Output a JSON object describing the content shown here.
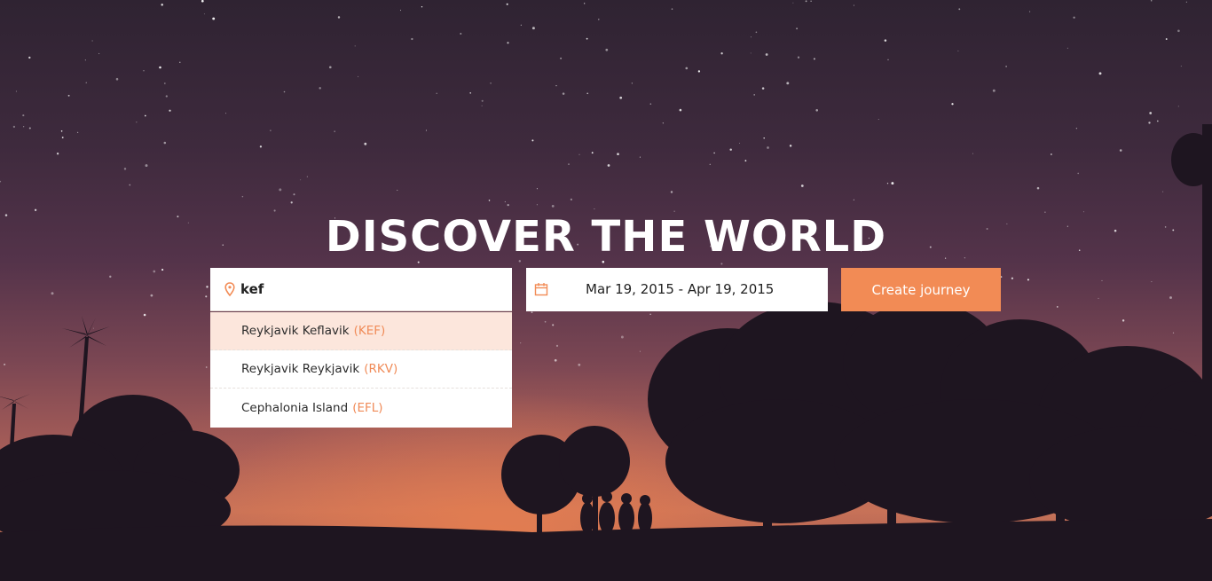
{
  "hero": {
    "title": "DISCOVER THE WORLD"
  },
  "search": {
    "value": "kef",
    "icon": "map-pin-icon",
    "suggestions": [
      {
        "name": "Reykjavik Keflavik",
        "code": "(KEF)",
        "active": true
      },
      {
        "name": "Reykjavik Reykjavik",
        "code": "(RKV)",
        "active": false
      },
      {
        "name": "Cephalonia Island",
        "code": "(EFL)",
        "active": false
      }
    ]
  },
  "dates": {
    "icon": "calendar-icon",
    "range": "Mar 19, 2015 - Apr 19, 2015"
  },
  "action": {
    "label": "Create journey"
  },
  "colors": {
    "accent": "#f28b55",
    "highlight": "#fce6dc",
    "code_text": "#f08b58"
  }
}
